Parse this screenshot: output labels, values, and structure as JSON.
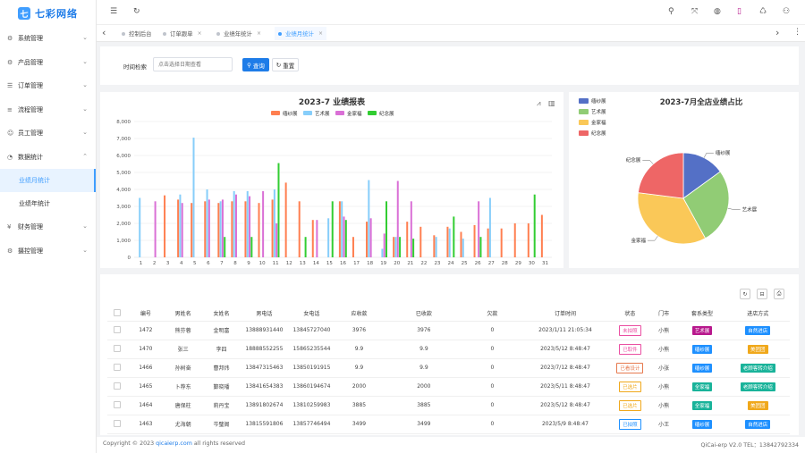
{
  "app": {
    "logo_mark": "七",
    "name": "七彩网络"
  },
  "sidebar": {
    "menus": [
      {
        "icon": "⚙",
        "label": "系统管理",
        "arrow": "⌄"
      },
      {
        "icon": "⚙",
        "label": "产品管理",
        "arrow": "⌄"
      },
      {
        "icon": "☰",
        "label": "订单管理",
        "arrow": "⌄"
      },
      {
        "icon": "≡",
        "label": "流程管理",
        "arrow": "⌄"
      },
      {
        "icon": "☺",
        "label": "员工管理",
        "arrow": "⌄"
      },
      {
        "icon": "◔",
        "label": "数据统计",
        "arrow": "⌃"
      }
    ],
    "subs": [
      {
        "label": "业绩月统计"
      },
      {
        "label": "业绩年统计"
      }
    ],
    "menus2": [
      {
        "icon": "¥",
        "label": "财务管理",
        "arrow": "⌄"
      },
      {
        "icon": "⚙",
        "label": "摄控管理",
        "arrow": "⌄"
      }
    ]
  },
  "topbar": {
    "icons": [
      "☰",
      "↻",
      "⚲",
      "⤧",
      "◍",
      "▯",
      "♺",
      "⚇"
    ]
  },
  "tabs": {
    "prev": "‹",
    "next": "›",
    "more": "⋮",
    "items": [
      {
        "label": "控制后台",
        "close": ""
      },
      {
        "label": "订单跟单",
        "close": "×"
      },
      {
        "label": "业绩年统计",
        "close": "×"
      },
      {
        "label": "业绩月统计",
        "close": "×"
      }
    ]
  },
  "filter": {
    "label": "时间检索",
    "placeholder": "点击选择日期查看",
    "search": "查询",
    "reset": "重置",
    "search_icon": "⚲",
    "reset_icon": "↻"
  },
  "bar_chart_ui": {
    "tool_icons": [
      "⩘",
      "▥"
    ]
  },
  "chart_data": [
    {
      "type": "bar",
      "title": "2023-7 业绩报表",
      "ylim": [
        0,
        8000
      ],
      "yticks": [
        "0",
        "1,000",
        "2,000",
        "3,000",
        "4,000",
        "5,000",
        "6,000",
        "7,000",
        "8,000"
      ],
      "categories": [
        "1",
        "2",
        "3",
        "4",
        "5",
        "6",
        "7",
        "8",
        "9",
        "10",
        "11",
        "12",
        "13",
        "14",
        "15",
        "16",
        "17",
        "18",
        "19",
        "20",
        "21",
        "22",
        "23",
        "24",
        "25",
        "26",
        "27",
        "28",
        "29",
        "30",
        "31"
      ],
      "legend_position": "top",
      "grid": true,
      "series": [
        {
          "name": "缅纱展",
          "color": "#ff7f50",
          "values": [
            0,
            0,
            3650,
            3400,
            3200,
            3300,
            3200,
            3300,
            3300,
            3200,
            3400,
            4400,
            3300,
            2200,
            0,
            3300,
            1200,
            2100,
            0,
            1200,
            2100,
            1800,
            1300,
            1800,
            1500,
            1900,
            1700,
            1700,
            2000,
            2000,
            2500
          ]
        },
        {
          "name": "艺术展",
          "color": "#87cefa",
          "values": [
            3500,
            0,
            0,
            3700,
            7050,
            4000,
            3300,
            3900,
            3900,
            0,
            4000,
            0,
            0,
            0,
            2300,
            3300,
            0,
            4550,
            500,
            1200,
            0,
            0,
            1200,
            1700,
            1100,
            0,
            3500,
            0,
            0,
            0,
            0
          ]
        },
        {
          "name": "金家福",
          "color": "#da70d6",
          "values": [
            0,
            3300,
            0,
            3200,
            0,
            3400,
            3400,
            3700,
            3600,
            3900,
            2000,
            0,
            0,
            2200,
            0,
            2400,
            0,
            2300,
            1400,
            4500,
            3300,
            0,
            0,
            0,
            0,
            3300,
            0,
            0,
            0,
            0,
            0
          ]
        },
        {
          "name": "纪念展",
          "color": "#32cd32",
          "values": [
            0,
            0,
            0,
            0,
            0,
            0,
            1200,
            0,
            1200,
            0,
            5550,
            0,
            1200,
            0,
            3300,
            2200,
            0,
            0,
            3300,
            1200,
            1100,
            0,
            0,
            2400,
            0,
            1200,
            0,
            0,
            0,
            3700,
            0
          ]
        }
      ]
    },
    {
      "type": "pie",
      "title": "2023-7月全店业绩占比",
      "legend_position": "top-left",
      "slices": [
        {
          "name": "缅纱展",
          "value": 15,
          "color": "#5470c6"
        },
        {
          "name": "艺术展",
          "value": 27,
          "color": "#91cc75"
        },
        {
          "name": "金家福",
          "value": 35,
          "color": "#fac858"
        },
        {
          "name": "纪念展",
          "value": 23,
          "color": "#ee6666"
        }
      ]
    }
  ],
  "table": {
    "tool_icons": [
      "↻",
      "⊟",
      "⎙"
    ],
    "headers": [
      "编号",
      "男姓名",
      "女姓名",
      "男电话",
      "女电话",
      "应收款",
      "已收款",
      "欠款",
      "订单时间",
      "状态",
      "门市",
      "套系类型",
      "进店方式"
    ],
    "rows": [
      {
        "id": "1472",
        "male": "熊芬蓉",
        "female": "金明富",
        "mphone": "13888931440",
        "fphone": "13845727040",
        "due": "3976",
        "paid": "3976",
        "owe": "0",
        "time": "2023/1/11 21:05:34",
        "status": "未拍照",
        "statusColor": "#ea4fa2",
        "shop": "小熊",
        "pkg": "艺术展",
        "pkgColor": "#b8198d",
        "entry": "自然进店",
        "entryColor": "#1e90ff"
      },
      {
        "id": "1470",
        "male": "张三",
        "female": "李四",
        "mphone": "18888552255",
        "fphone": "15865235544",
        "due": "9.9",
        "paid": "9.9",
        "owe": "0",
        "time": "2023/5/12 8:48:47",
        "status": "已取件",
        "statusColor": "#ea4fa2",
        "shop": "小熊",
        "pkg": "缅纱展",
        "pkgColor": "#1e90ff",
        "entry": "美团团",
        "entryColor": "#f0a81b"
      },
      {
        "id": "1466",
        "male": "孙树奋",
        "female": "曹邦炜",
        "mphone": "13847315463",
        "fphone": "13850191915",
        "due": "9.9",
        "paid": "9.9",
        "owe": "0",
        "time": "2023/7/12 8:48:47",
        "status": "已看设计",
        "statusColor": "#e6794d",
        "shop": "小张",
        "pkg": "缅纱展",
        "pkgColor": "#1e90ff",
        "entry": "老顾客转介绍",
        "entryColor": "#19b39a"
      },
      {
        "id": "1465",
        "male": "卜荐东",
        "female": "鄞晓璠",
        "mphone": "13841654383",
        "fphone": "13860194674",
        "due": "2000",
        "paid": "2000",
        "owe": "0",
        "time": "2023/5/11 8:48:47",
        "status": "已选片",
        "statusColor": "#f0a81b",
        "shop": "小熊",
        "pkg": "全家福",
        "pkgColor": "#19b39a",
        "entry": "老顾客转介绍",
        "entryColor": "#19b39a"
      },
      {
        "id": "1464",
        "male": "唐保柱",
        "female": "莉丹宝",
        "mphone": "13891802674",
        "fphone": "13810259983",
        "due": "3885",
        "paid": "3885",
        "owe": "0",
        "time": "2023/5/12 8:48:47",
        "status": "已选片",
        "statusColor": "#f0a81b",
        "shop": "小熊",
        "pkg": "全家福",
        "pkgColor": "#19b39a",
        "entry": "美团团",
        "entryColor": "#f0a81b"
      },
      {
        "id": "1463",
        "male": "尤海朝",
        "female": "岑璧阁",
        "mphone": "13815591806",
        "fphone": "13857746494",
        "due": "3499",
        "paid": "3499",
        "owe": "0",
        "time": "2023/5/9 8:48:47",
        "status": "已拍照",
        "statusColor": "#1e90ff",
        "shop": "小王",
        "pkg": "缅纱展",
        "pkgColor": "#1e90ff",
        "entry": "自然进店",
        "entryColor": "#1e90ff"
      }
    ]
  },
  "footer": {
    "copyright_prefix": "Copyright © 2023",
    "link": "qicaierp.com",
    "copyright_suffix": "all rights reserved",
    "version": "QiCai-erp V2.0 TEL：13842792334"
  }
}
